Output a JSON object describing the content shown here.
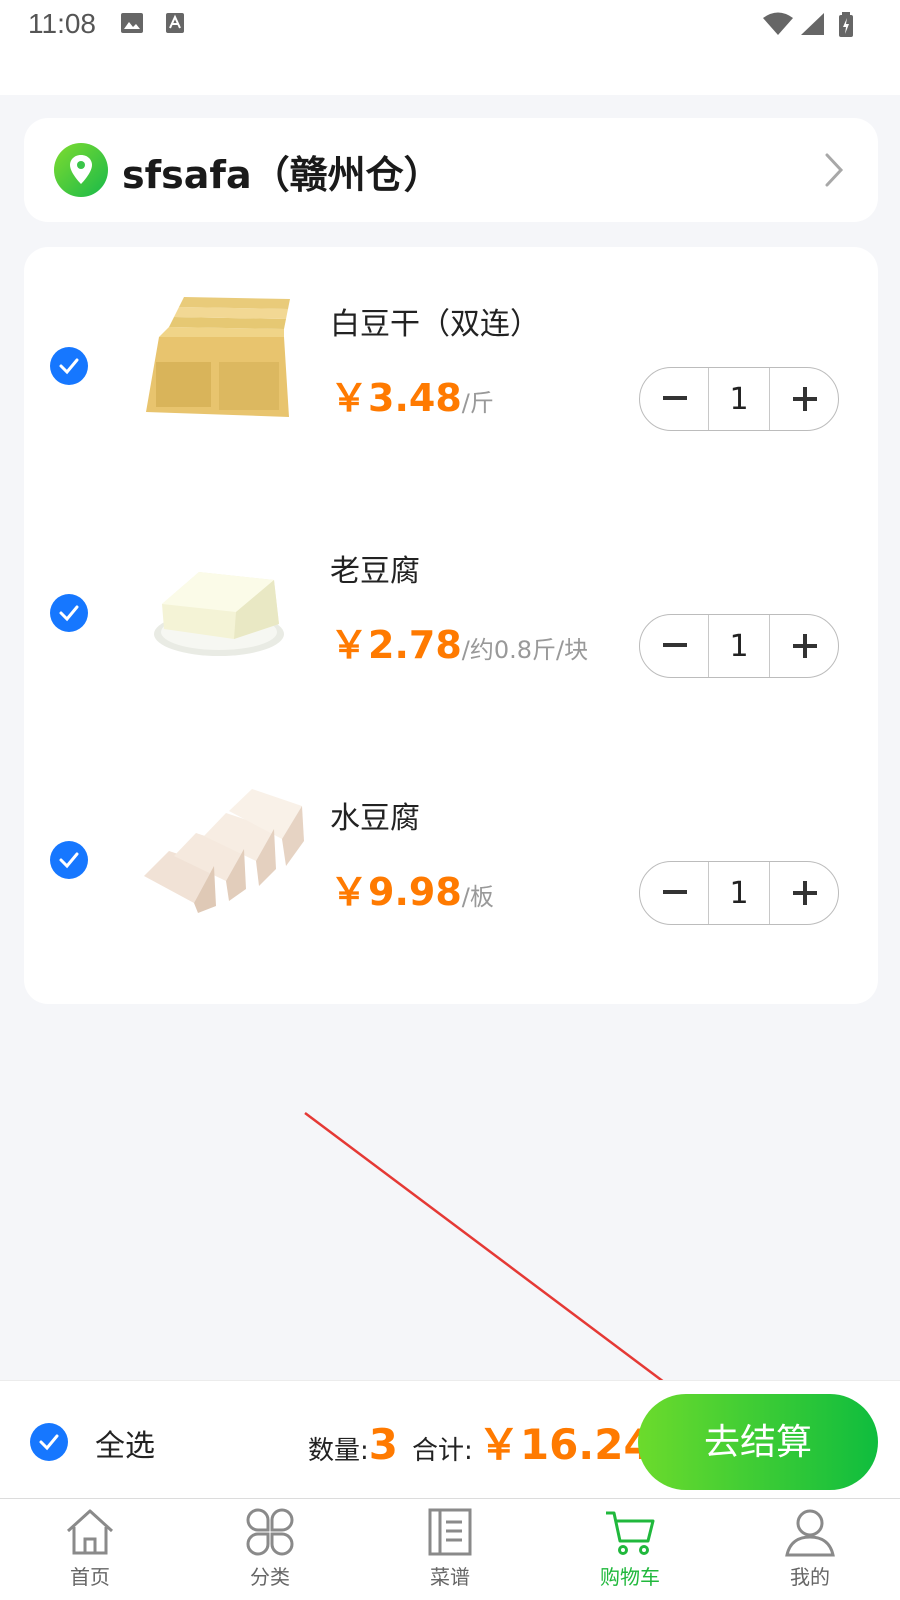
{
  "status_bar": {
    "time": "11:08"
  },
  "store": {
    "name": "sfsafa（赣州仓）"
  },
  "items": [
    {
      "name": "白豆干（双连）",
      "price": "￥3.48",
      "unit": "/斤",
      "qty": "1"
    },
    {
      "name": "老豆腐",
      "price": "￥2.78",
      "unit": "/约0.8斤/块",
      "qty": "1"
    },
    {
      "name": "水豆腐",
      "price": "￥9.98",
      "unit": "/板",
      "qty": "1"
    }
  ],
  "checkout": {
    "select_all": "全选",
    "count_label": "数量:",
    "count": "3",
    "total_label": "合计:",
    "total": "￥16.24",
    "button": "去结算"
  },
  "tabs": [
    {
      "label": "首页",
      "icon": "home-icon"
    },
    {
      "label": "分类",
      "icon": "category-icon"
    },
    {
      "label": "菜谱",
      "icon": "recipe-book-icon"
    },
    {
      "label": "购物车",
      "icon": "cart-icon",
      "active": true
    },
    {
      "label": "我的",
      "icon": "profile-icon"
    }
  ],
  "colors": {
    "accent_green": "#20b83c",
    "price_orange": "#ff7a00",
    "check_blue": "#1677ff",
    "annotation_red": "#e53935"
  }
}
